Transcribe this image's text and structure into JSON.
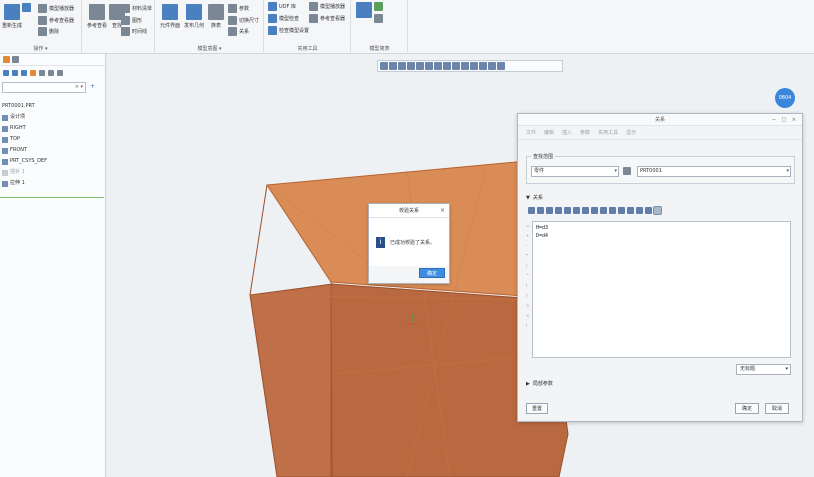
{
  "ribbon": {
    "groups": [
      {
        "title": "操作 ▾"
      },
      {
        "title": "模型意图 ▾"
      },
      {
        "title": "实用工具"
      },
      {
        "title": "模型简表"
      }
    ],
    "buttons": {
      "regen": "重新生成",
      "user_param": "参考查看",
      "cross": "查找",
      "delete": "删除",
      "family_table": "族表",
      "switch_dim": "切换尺寸",
      "relations": "关系",
      "params": "参数",
      "component_interface": "元件界面",
      "publish_geom": "发布几何",
      "udf": "UDF 库",
      "model_player": "模型播放器",
      "ref_viewer": "参考查看器",
      "bom": "材料清单",
      "graph": "图形",
      "timeline": "时间线",
      "model_check": "模型检查",
      "model_check_settings": "检查模型设置"
    }
  },
  "sidebar": {
    "filter_placeholder": "",
    "items": [
      {
        "label": "PRT0001.PRT",
        "dim": false
      },
      {
        "label": "设计项",
        "dim": false
      },
      {
        "label": "RIGHT",
        "dim": false
      },
      {
        "label": "TOP",
        "dim": false
      },
      {
        "label": "FRONT",
        "dim": false
      },
      {
        "label": "PRT_CSYS_DEF",
        "dim": false
      },
      {
        "label": "插补 1",
        "dim": true
      },
      {
        "label": "拉伸 1",
        "dim": false
      }
    ]
  },
  "viewport": {
    "badge": "0804"
  },
  "message_dialog": {
    "title": "校验关系",
    "text": "已成功校验了关系。",
    "ok": "确定",
    "close": "×"
  },
  "relations_dialog": {
    "title": "关系",
    "window_buttons": "− □ ×",
    "menu": [
      "文件",
      "编辑",
      "插入",
      "参数",
      "实用工具",
      "显示"
    ],
    "scope_label": "查找范围",
    "scope_type": "零件",
    "scope_object": "PRT0001",
    "section_label": "关系",
    "lines": [
      "H=d3",
      "D=d4"
    ],
    "units": "无标题",
    "local_params": "局部参数",
    "gutter": [
      "=",
      "+",
      "-",
      "*",
      "/",
      "^",
      "(",
      ")",
      ">",
      "<",
      "!"
    ],
    "reset": "重置",
    "ok": "确定",
    "cancel": "取消"
  }
}
